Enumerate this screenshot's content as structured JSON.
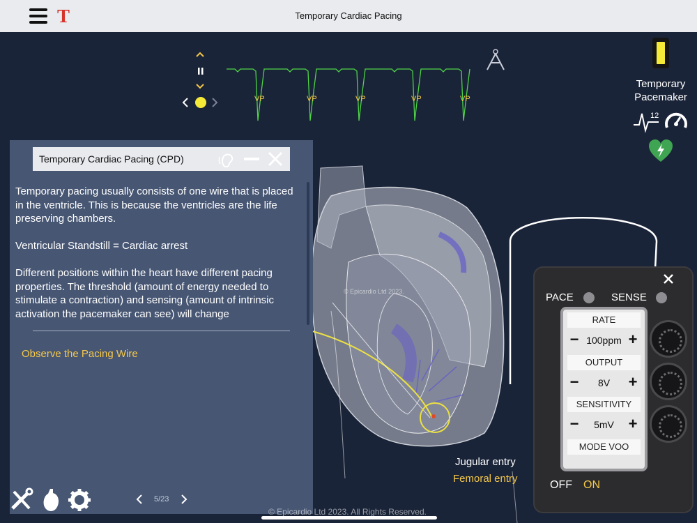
{
  "app": {
    "title": "Temporary Cardiac Pacing",
    "logo": "T"
  },
  "colors": {
    "accent": "#f5c84a",
    "ecg": "#4fd447",
    "panel": "#475673",
    "background": "#1a2438",
    "logo": "#d6332b"
  },
  "icons": [
    "menu-icon",
    "logo-icon",
    "chevron-up-icon",
    "pause-icon",
    "chevron-down-icon",
    "chevron-left-icon",
    "chevron-right-icon",
    "calipers-icon",
    "battery-icon",
    "ecg-12-lead-icon",
    "speedometer-icon",
    "defibrillator-heart-icon",
    "tools-icon",
    "heart-model-icon",
    "gear-icon"
  ],
  "ecg": {
    "markers": [
      "VP",
      "VP",
      "VP",
      "VP",
      "VP"
    ]
  },
  "sidebar": {
    "pacemaker_label_1": "Temporary",
    "pacemaker_label_2": "Pacemaker",
    "ecg_badge": "12"
  },
  "panel": {
    "title": "Temporary Cardiac Pacing (CPD)",
    "paragraphs": [
      "Temporary pacing usually consists of one wire that is placed in the ventricle.  This is because the ventricles are the life preserving chambers.",
      "Ventricular Standstill = Cardiac arrest",
      "Different positions within the heart have different pacing properties.  The threshold (amount of energy needed to stimulate a contraction) and sensing (amount of intrinsic activation the pacemaker can see) will change"
    ],
    "link": "Observe the Pacing Wire",
    "page": "5/23"
  },
  "scene": {
    "copyright_mid": "© Epicardio Ltd 2023.",
    "copyright_bottom": "© Epicardio Ltd 2023. All Rights Reserved.",
    "jugular_label": "Jugular entry",
    "femoral_label": "Femoral entry"
  },
  "pacemaker": {
    "pace_label": "PACE",
    "sense_label": "SENSE",
    "rate_label": "RATE",
    "rate_value": "100ppm",
    "output_label": "OUTPUT",
    "output_value": "8V",
    "sensitivity_label": "SENSITIVITY",
    "sensitivity_value": "5mV",
    "mode_label": "MODE VOO",
    "off_label": "OFF",
    "on_label": "ON"
  }
}
